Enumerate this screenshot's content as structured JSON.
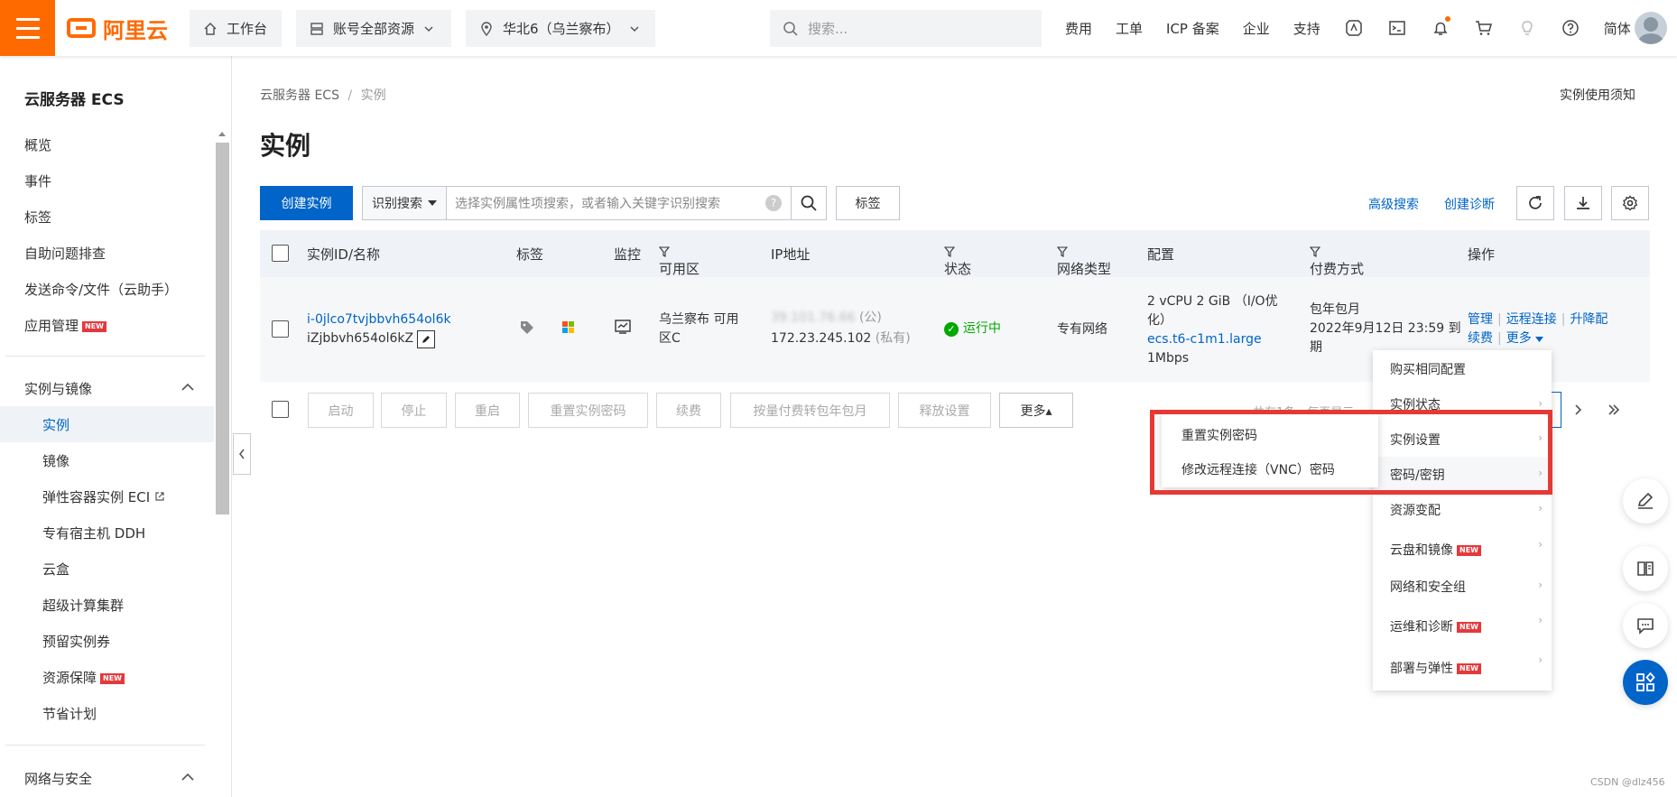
{
  "topbar": {
    "logo_text": "阿里云",
    "workbench": "工作台",
    "account_resources": "账号全部资源",
    "region": "华北6（乌兰察布）",
    "search_placeholder": "搜索...",
    "links": [
      "费用",
      "工单",
      "ICP 备案",
      "企业",
      "支持"
    ],
    "language": "简体"
  },
  "sidebar": {
    "title": "云服务器 ECS",
    "items": [
      "概览",
      "事件",
      "标签",
      "自助问题排查",
      "发送命令/文件（云助手）",
      "应用管理"
    ],
    "group1": "实例与镜像",
    "group1_items": [
      "实例",
      "镜像",
      "弹性容器实例 ECI",
      "专有宿主机 DDH",
      "云盒",
      "超级计算集群",
      "预留实例券",
      "资源保障",
      "节省计划"
    ],
    "group2": "网络与安全",
    "new_badge": "NEW"
  },
  "page": {
    "breadcrumb_root": "云服务器 ECS",
    "breadcrumb_sep": "/",
    "breadcrumb_current": "实例",
    "notice": "实例使用须知",
    "title": "实例",
    "create_button": "创建实例",
    "filter_select": "识别搜索",
    "filter_placeholder": "选择实例属性项搜索，或者输入关键字识别搜索",
    "tag_button": "标签",
    "advanced_search": "高级搜索",
    "create_diagnosis": "创建诊断"
  },
  "table": {
    "headers": [
      "实例ID/名称",
      "标签",
      "监控",
      "可用区",
      "IP地址",
      "状态",
      "网络类型",
      "配置",
      "付费方式",
      "操作"
    ],
    "row": {
      "instance_id": "i-0jlco7tvjbbvh654ol6k",
      "instance_name": "iZjbbvh654ol6kZ",
      "zone_line1": "乌兰察布 可用",
      "zone_line2": "区C",
      "public_ip": "39.101.76.66",
      "public_suffix": "(公)",
      "private_ip": "172.23.245.102",
      "private_suffix": "(私有)",
      "status": "运行中",
      "network": "专有网络",
      "config_line1": "2 vCPU 2 GiB （I/O优",
      "config_line2": "化）",
      "config_type": "ecs.t6-c1m1.large",
      "config_bw": "1Mbps",
      "pay_line1": "包年包月",
      "pay_line2": "2022年9月12日 23:59 到",
      "pay_line3": "期",
      "ops": [
        "管理",
        "远程连接",
        "升降配",
        "续费",
        "更多"
      ]
    }
  },
  "bulk": {
    "buttons": [
      "启动",
      "停止",
      "重启",
      "重置实例密码",
      "续费",
      "按量付费转包年包月",
      "释放设置",
      "更多▴"
    ],
    "pager_hidden": "共有1条，每页显示"
  },
  "menu_more": {
    "items": [
      "购买相同配置",
      "实例状态",
      "实例设置",
      "密码/密钥",
      "资源变配",
      "云盘和镜像",
      "网络和安全组",
      "运维和诊断",
      "部署与弹性"
    ]
  },
  "submenu_password": {
    "items": [
      "重置实例密码",
      "修改远程连接（VNC）密码"
    ]
  },
  "watermark": "CSDN @dlz456",
  "colors": {
    "brand": "#ff6a00",
    "primary": "#0064c8",
    "success": "#00a700",
    "highlight": "#e53935"
  }
}
